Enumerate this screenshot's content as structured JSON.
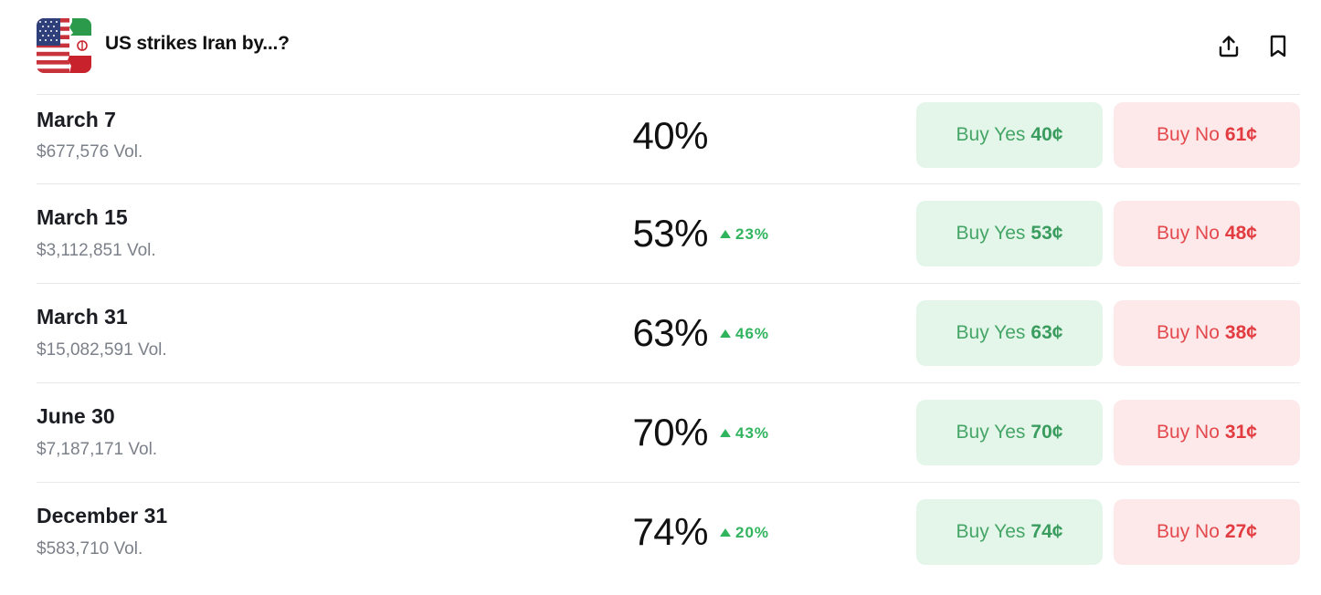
{
  "header": {
    "title": "US strikes Iran by...?",
    "share_icon": "share-upload-icon",
    "bookmark_icon": "bookmark-icon",
    "thumbnail": "us-iran-flags-thumbnail"
  },
  "colors": {
    "yes_bg": "#e4f6e9",
    "yes_text": "#44a566",
    "no_bg": "#fde9ea",
    "no_text": "#e3494d",
    "up_change": "#31b45e"
  },
  "markets": [
    {
      "title": "March 7",
      "volume": "$677,576 Vol.",
      "probability": "40%",
      "change": "",
      "yes_label": "Buy Yes",
      "yes_price": "40¢",
      "no_label": "Buy No",
      "no_price": "61¢"
    },
    {
      "title": "March 15",
      "volume": "$3,112,851 Vol.",
      "probability": "53%",
      "change": "23%",
      "yes_label": "Buy Yes",
      "yes_price": "53¢",
      "no_label": "Buy No",
      "no_price": "48¢"
    },
    {
      "title": "March 31",
      "volume": "$15,082,591 Vol.",
      "probability": "63%",
      "change": "46%",
      "yes_label": "Buy Yes",
      "yes_price": "63¢",
      "no_label": "Buy No",
      "no_price": "38¢"
    },
    {
      "title": "June 30",
      "volume": "$7,187,171 Vol.",
      "probability": "70%",
      "change": "43%",
      "yes_label": "Buy Yes",
      "yes_price": "70¢",
      "no_label": "Buy No",
      "no_price": "31¢"
    },
    {
      "title": "December 31",
      "volume": "$583,710 Vol.",
      "probability": "74%",
      "change": "20%",
      "yes_label": "Buy Yes",
      "yes_price": "74¢",
      "no_label": "Buy No",
      "no_price": "27¢"
    }
  ]
}
